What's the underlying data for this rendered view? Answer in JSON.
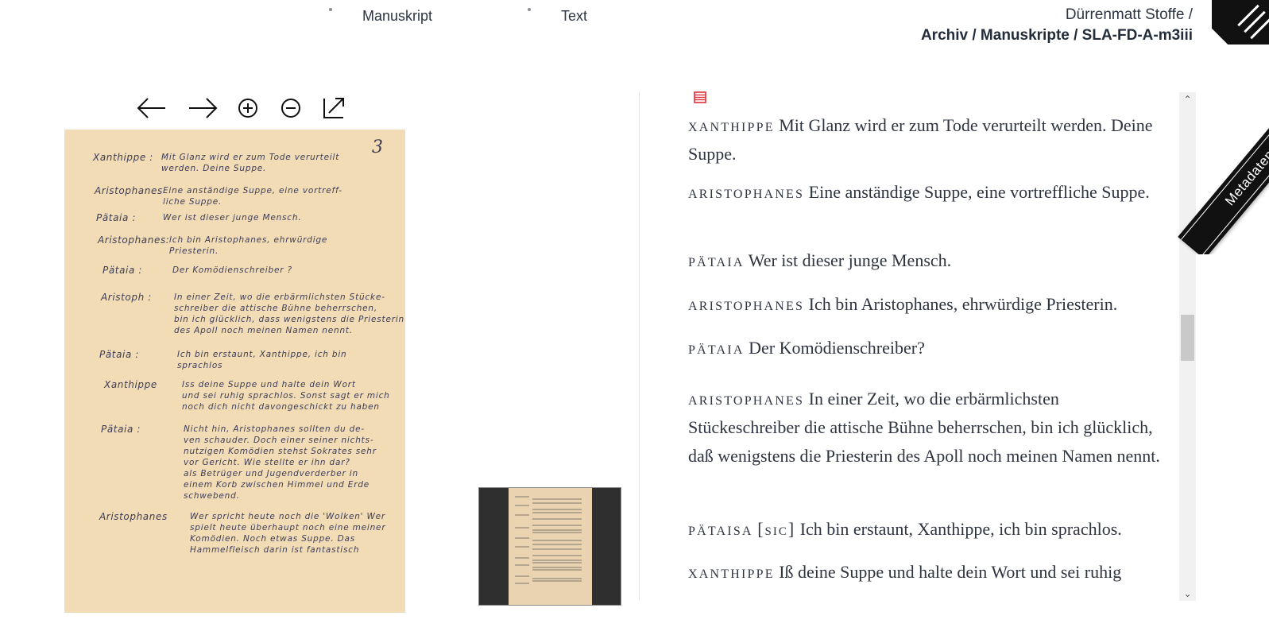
{
  "nav": {
    "tabs": [
      {
        "label": "Manuskript"
      },
      {
        "label": "Text"
      }
    ]
  },
  "breadcrumb": {
    "line1": "Dürrenmatt Stoffe /",
    "line2": "Archiv / Manuskripte / SLA-FD-A-m3iii"
  },
  "viewer": {
    "tools": [
      "arrow-left-icon",
      "arrow-right-icon",
      "zoom-in-icon",
      "zoom-out-icon",
      "open-external-icon"
    ]
  },
  "manuscript": {
    "page_number": "3",
    "rows": [
      {
        "speaker": "Xanthippe :",
        "text": [
          "Mit Glanz wird er zum Tode verurteilt",
          "werden. Deine Suppe."
        ]
      },
      {
        "speaker": "Aristophanes",
        "text": [
          "Eine anständige Suppe, eine vortreff-",
          "liche Suppe."
        ]
      },
      {
        "speaker": "Pätaia :",
        "text": [
          "Wer ist dieser junge Mensch."
        ]
      },
      {
        "speaker": "Aristophanes:",
        "text": [
          "Ich bin Aristophanes, ehrwürdige",
          "Priesterin."
        ]
      },
      {
        "speaker": "Pätaia :",
        "text": [
          "Der Komödienschreiber ?"
        ]
      },
      {
        "speaker": "Aristoph :",
        "text": [
          "In einer Zeit, wo die erbärmlichsten Stücke-",
          "schreiber die attische Bühne beherrschen,",
          "bin ich glücklich, dass wenigstens die Priesterin",
          "des Apoll noch meinen Namen nennt."
        ]
      },
      {
        "speaker": "Pätaia :",
        "text": [
          "Ich bin erstaunt, Xanthippe, ich bin",
          "sprachlos"
        ]
      },
      {
        "speaker": "Xanthippe",
        "text": [
          "Iss deine Suppe und halte dein Wort",
          "und sei ruhig sprachlos. Sonst sagt er mich",
          "noch dich nicht davongeschickt zu haben"
        ]
      },
      {
        "speaker": "Pätaia :",
        "text": [
          "Nicht hin, Aristophanes sollten du de-",
          "ven schauder. Doch einer seiner nichts-",
          "nutzigen Komödien stehst Sokrates sehr",
          "vor Gericht. Wie stellte er ihn dar?",
          "als Betrüger und Jugendverderber in",
          "einem Korb zwischen Himmel und Erde",
          "schwebend."
        ]
      },
      {
        "speaker": "Aristophanes",
        "text": [
          "Wer spricht heute noch die 'Wolken' Wer",
          "spielt heute überhaupt noch eine meiner",
          "Komödien. Noch etwas Suppe. Das",
          "Hammelfleisch darin ist fantastisch"
        ]
      }
    ]
  },
  "transcript": {
    "paragraphs": [
      {
        "speaker": "Xanthippe",
        "text": "Mit Glanz wird er zum Tode verurteilt werden. Deine Suppe."
      },
      {
        "speaker": "Aristophanes",
        "text": "Eine anständige Suppe, eine vortreffliche Suppe."
      },
      {
        "speaker": "Pätaia",
        "text": "Wer ist dieser junge Mensch."
      },
      {
        "speaker": "Aristophanes",
        "text": "Ich bin Aristophanes, ehrwürdige Priesterin."
      },
      {
        "speaker": "Pätaia",
        "text": "Der Komödienschreiber?"
      },
      {
        "speaker": "Aristophanes",
        "text": "In einer Zeit, wo die erbärmlichsten Stückeschreiber die attische Bühne beherrschen, bin ich glücklich, daß wenigstens die Priesterin des Apoll noch meinen Namen nennt."
      },
      {
        "speaker": "Pätaisa",
        "sic": "[sic]",
        "text": "Ich bin erstaunt, Xanthippe, ich bin sprachlos."
      },
      {
        "speaker": "Xanthippe",
        "text": "Iß deine Suppe und halte dein Wort und sei ruhig"
      }
    ]
  },
  "metadata_tab": {
    "label": "Metadaten"
  },
  "colors": {
    "accent_red": "#e0303a",
    "paper": "#f1dcb6",
    "ink": "#3e3c58"
  }
}
